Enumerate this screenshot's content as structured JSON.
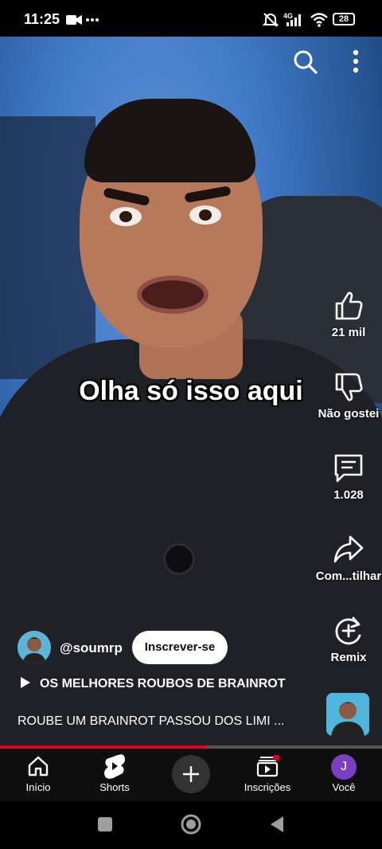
{
  "status_bar": {
    "time": "11:25",
    "icons": [
      "video-camera-icon",
      "more-dots-icon",
      "mute-icon",
      "signal-4g-icon",
      "wifi-icon",
      "battery-icon"
    ],
    "network": "4G",
    "battery": "28"
  },
  "video": {
    "caption": "Olha só isso aqui",
    "progress_fraction": 0.54
  },
  "top_actions": [
    "search-icon",
    "more-vert-icon"
  ],
  "actions": {
    "like": "21 mil",
    "dislike": "Não gostei",
    "comments": "1.028",
    "share": "Com...tilhar",
    "remix": "Remix"
  },
  "channel": {
    "name": "@soumrp",
    "subscribe_label": "Inscrever-se"
  },
  "playlist_title": "OS MELHORES ROUBOS DE BRAINROT",
  "video_title": "ROUBE UM BRAINROT PASSOU DOS LIMI ...",
  "bottom_nav": {
    "home": "Início",
    "shorts": "Shorts",
    "subscriptions": "Inscrições",
    "you": "Você",
    "avatar_letter": "J"
  },
  "colors": {
    "accent_red": "#e00025",
    "avatar_purple": "#7b3fc4",
    "nav_bg": "#0f0f0f"
  }
}
